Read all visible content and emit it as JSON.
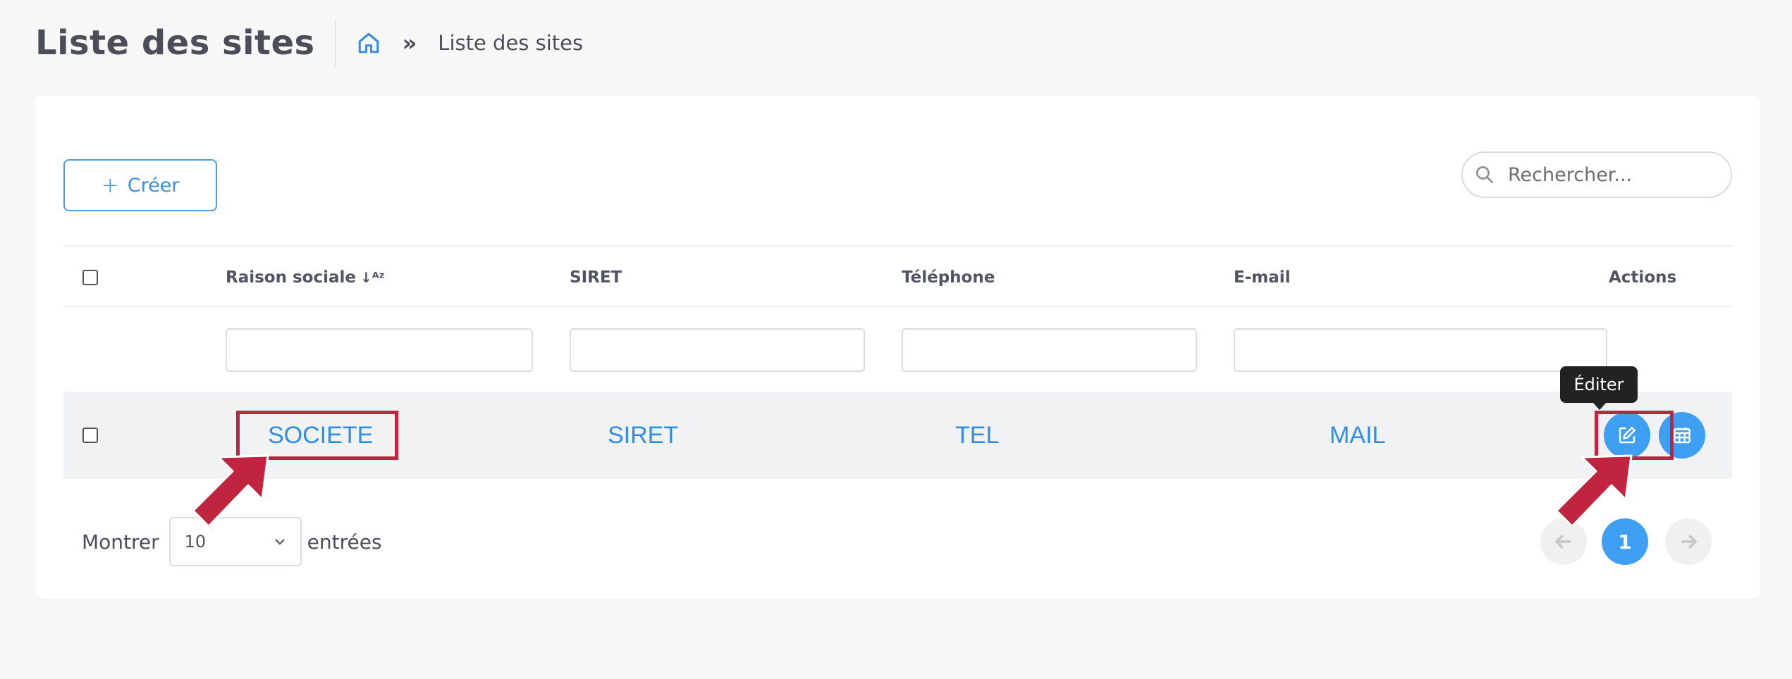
{
  "header": {
    "title": "Liste des sites",
    "breadcrumb_separator": "»",
    "breadcrumb_current": "Liste des sites"
  },
  "toolbar": {
    "create_icon": "+",
    "create_label": "Créer",
    "search_placeholder": "Rechercher..."
  },
  "table": {
    "columns": [
      "Raison sociale",
      "SIRET",
      "Téléphone",
      "E-mail",
      "Actions"
    ],
    "sort_indicator": "↓ᴬᶻ",
    "rows": [
      {
        "raison_sociale": "SOCIETE",
        "siret": "SIRET",
        "telephone": "TEL",
        "email": "MAIL"
      }
    ],
    "actions": {
      "edit_tooltip": "Éditer"
    }
  },
  "footer": {
    "show_label": "Montrer",
    "page_size": "10",
    "entries_label": "entrées",
    "current_page": "1"
  },
  "colors": {
    "accent": "#3f9ff2",
    "link": "#2f8de4",
    "highlight": "#c0243e"
  }
}
